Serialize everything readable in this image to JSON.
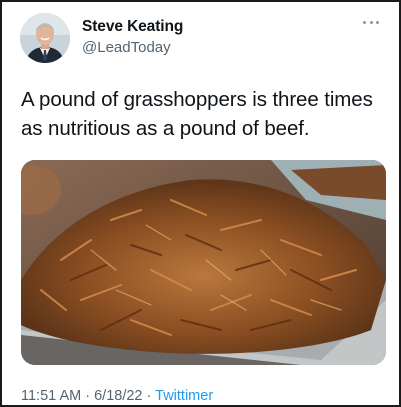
{
  "author": {
    "display_name": "Steve Keating",
    "handle": "@LeadToday"
  },
  "tweet": {
    "text": "A pound of grasshoppers is three times as nutritious as a pound of beef."
  },
  "meta": {
    "time": "11:51 AM",
    "date": "6/18/22",
    "separator": "·",
    "source": "Twittimer"
  },
  "icons": {
    "more": "more-horizontal-icon"
  },
  "colors": {
    "text": "#0f1419",
    "secondary": "#536471",
    "link": "#1d9bf0"
  }
}
